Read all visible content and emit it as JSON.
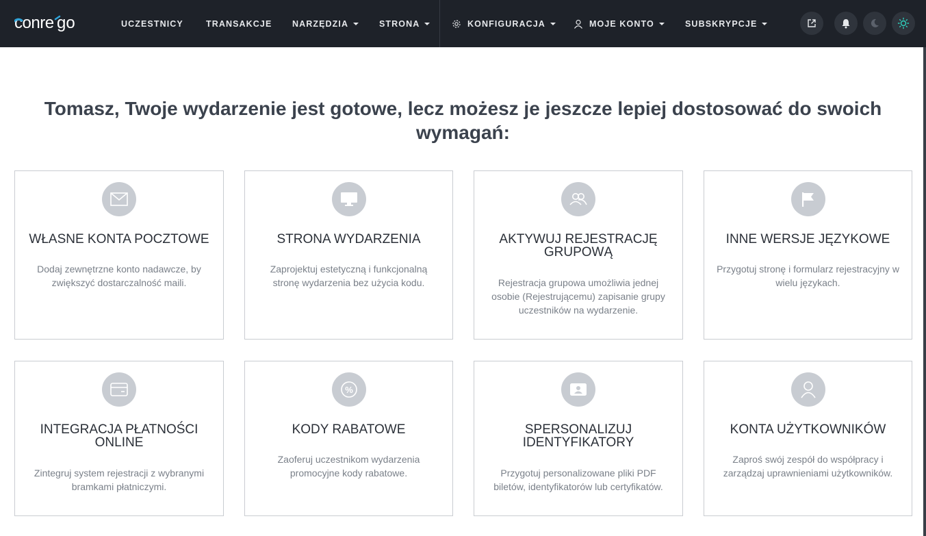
{
  "brand": {
    "logo_text": "conrego",
    "accent_color": "#2fa3d8"
  },
  "nav": {
    "items": [
      {
        "label": "UCZESTNICY",
        "has_caret": false
      },
      {
        "label": "TRANSAKCJE",
        "has_caret": false
      },
      {
        "label": "NARZĘDZIA",
        "has_caret": true
      },
      {
        "label": "STRONA",
        "has_caret": true
      },
      {
        "label": "KONFIGURACJA",
        "has_caret": true,
        "icon": "gear-icon"
      },
      {
        "label": "MOJE KONTO",
        "has_caret": true,
        "icon": "user-icon"
      },
      {
        "label": "SUBSKRYPCJE",
        "has_caret": true
      }
    ],
    "buttons": [
      "external-link-icon",
      "bell-icon",
      "moon-icon",
      "sun-icon"
    ]
  },
  "heading": "Tomasz, Twoje wydarzenie jest gotowe, lecz możesz je jeszcze lepiej dostosować do swoich wymagań:",
  "cards": [
    {
      "icon": "envelope-icon",
      "title": "WŁASNE KONTA POCZTOWE",
      "desc": "Dodaj zewnętrzne konto nadawcze, by zwiększyć dostarczalność maili."
    },
    {
      "icon": "monitor-icon",
      "title": "STRONA WYDARZENIA",
      "desc": "Zaprojektuj estetyczną i funkcjonalną stronę wydarzenia bez użycia kodu."
    },
    {
      "icon": "group-icon",
      "title": "AKTYWUJ REJESTRACJĘ GRUPOWĄ",
      "desc": "Rejestracja grupowa umożliwia jednej osobie (Rejestrującemu) zapisanie grupy uczestników na wydarzenie."
    },
    {
      "icon": "flag-icon",
      "title": "INNE WERSJE JĘZYKOWE",
      "desc": "Przygotuj stronę i formularz rejestracyjny w wielu językach."
    },
    {
      "icon": "credit-card-icon",
      "title": "INTEGRACJA PŁATNOŚCI ONLINE",
      "desc": "Zintegruj system rejestracji z wybranymi bramkami płatniczymi."
    },
    {
      "icon": "discount-icon",
      "title": "KODY RABATOWE",
      "desc": "Zaoferuj uczestnikom wydarzenia promocyjne kody rabatowe."
    },
    {
      "icon": "id-badge-icon",
      "title": "SPERSONALIZUJ IDENTYFIKATORY",
      "desc": "Przygotuj personalizowane pliki PDF biletów, identyfikatorów lub certyfikatów."
    },
    {
      "icon": "user-circle-icon",
      "title": "KONTA UŻYTKOWNIKÓW",
      "desc": "Zaproś swój zespół do współpracy i zarządzaj uprawnieniami użytkowników."
    }
  ]
}
